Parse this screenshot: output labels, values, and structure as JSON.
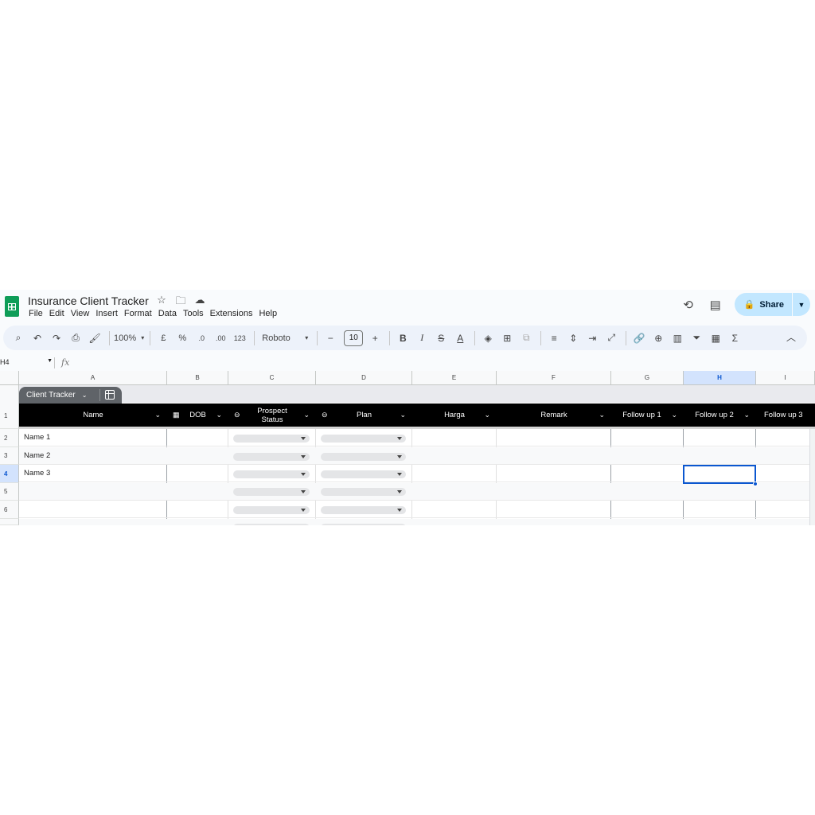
{
  "doc": {
    "title": "Insurance Client Tracker",
    "menu": [
      "File",
      "Edit",
      "View",
      "Insert",
      "Format",
      "Data",
      "Tools",
      "Extensions",
      "Help"
    ]
  },
  "header": {
    "share_label": "Share"
  },
  "toolbar": {
    "zoom": "100%",
    "currency": "£",
    "percent": "%",
    "decrease_decimal": ".0",
    "increase_decimal": ".00",
    "number_format": "123",
    "font": "Roboto",
    "font_size": "10"
  },
  "formula_bar": {
    "cell_ref": "H4",
    "fx": "fx",
    "value": ""
  },
  "grid": {
    "columns": [
      "A",
      "B",
      "C",
      "D",
      "E",
      "F",
      "G",
      "H",
      "I"
    ],
    "selected_column": "H",
    "rows": [
      "1",
      "2",
      "3",
      "4",
      "5",
      "6"
    ],
    "selected_row": "4"
  },
  "table": {
    "name": "Client Tracker",
    "headers": [
      "Name",
      "DOB",
      "Prospect Status",
      "Plan",
      "Harga",
      "Remark",
      "Follow up 1",
      "Follow up 2",
      "Follow up 3"
    ],
    "names": [
      "Name 1",
      "Name 2",
      "Name 3",
      "",
      ""
    ]
  },
  "colors": {
    "accent": "#0b57d0",
    "share_bg": "#c2e7ff",
    "sheets_green": "#0f9d58",
    "header_bg": "#000000"
  }
}
